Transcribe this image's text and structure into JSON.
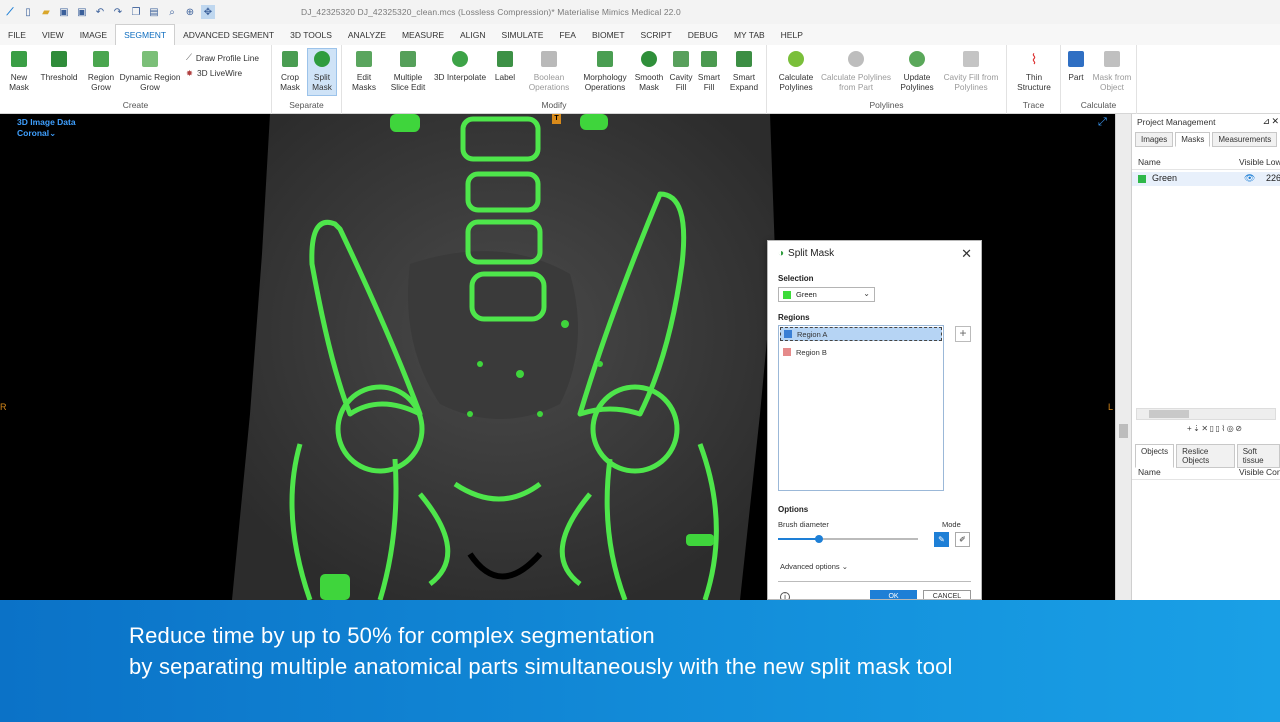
{
  "titlebar": {
    "title": "DJ_42325320   DJ_42325320_clean.mcs   (Lossless Compression)*   Materialise Mimics Medical 22.0"
  },
  "menu": {
    "tabs": [
      "FILE",
      "VIEW",
      "IMAGE",
      "SEGMENT",
      "ADVANCED SEGMENT",
      "3D TOOLS",
      "ANALYZE",
      "MEASURE",
      "ALIGN",
      "SIMULATE",
      "FEA",
      "BIOMET",
      "SCRIPT",
      "DEBUG",
      "MY TAB",
      "HELP"
    ],
    "active": "SEGMENT"
  },
  "ribbon": {
    "create": {
      "label": "Create",
      "new_mask": "New Mask",
      "threshold": "Threshold",
      "region_grow": "Region Grow",
      "dynamic_region_grow": "Dynamic Region Grow",
      "draw_profile_line": "Draw Profile Line",
      "live_wire": "3D LiveWire"
    },
    "separate": {
      "label": "Separate",
      "crop_mask": "Crop Mask",
      "split_mask": "Split Mask"
    },
    "modify": {
      "label": "Modify",
      "edit_masks": "Edit Masks",
      "multiple_slice_edit": "Multiple Slice Edit",
      "interpolate": "3D Interpolate",
      "label_btn": "Label",
      "boolean": "Boolean Operations",
      "morphology": "Morphology Operations",
      "smooth_mask": "Smooth Mask",
      "cavity_fill": "Cavity Fill",
      "smart_fill": "Smart Fill",
      "smart_expand": "Smart Expand"
    },
    "polylines": {
      "label": "Polylines",
      "calculate": "Calculate Polylines",
      "calculate_from_part": "Calculate Polylines from Part",
      "update": "Update Polylines",
      "cavity_fill": "Cavity Fill from Polylines"
    },
    "trace": {
      "label": "Trace",
      "thin_structure": "Thin Structure"
    },
    "calculate": {
      "label": "Calculate",
      "part": "Part",
      "mask_from_object": "Mask from Object"
    }
  },
  "viewport": {
    "data_label": "3D Image Data",
    "view_label": "Coronal",
    "orient_top": "T",
    "orient_left": "R",
    "orient_right": "L"
  },
  "dialog": {
    "title": "Split Mask",
    "selection_label": "Selection",
    "selection_value": "Green",
    "regions_label": "Regions",
    "regions": [
      {
        "name": "Region A",
        "color": "#3a7fd5"
      },
      {
        "name": "Region B",
        "color": "#e58a8a"
      }
    ],
    "options_label": "Options",
    "brush_label": "Brush diameter",
    "brush_value": 0.29,
    "mode_label": "Mode",
    "advanced_label": "Advanced options",
    "ok": "OK",
    "cancel": "CANCEL"
  },
  "panel": {
    "title": "Project Management",
    "tabs": [
      "Images",
      "Masks",
      "Measurements"
    ],
    "active_tab": "Masks",
    "columns": [
      "Name",
      "Visible",
      "Low"
    ],
    "mask": {
      "name": "Green",
      "color": "#2fb84a",
      "low": "226"
    },
    "tabs2": [
      "Objects",
      "Reslice Objects",
      "Soft tissue"
    ],
    "columns2": [
      "Name",
      "Visible",
      "Contour"
    ]
  },
  "caption": {
    "line1": "Reduce time by up to 50% for complex segmentation",
    "line2": "by separating multiple anatomical parts simultaneously with the new split mask tool"
  },
  "colors": {
    "accent": "#0e6dbf",
    "mask_green": "#3ddc3a",
    "caption_bg": "#0b72c7"
  }
}
